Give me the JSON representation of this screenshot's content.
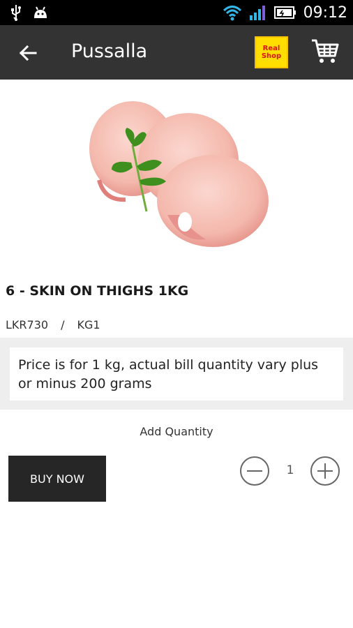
{
  "status_bar": {
    "time": "09:12",
    "icons": [
      "usb-icon",
      "android-icon",
      "wifi-icon",
      "signal-icon",
      "battery-icon"
    ]
  },
  "app_bar": {
    "title": "Pussalla",
    "logo_text": [
      "Real",
      "Shop"
    ],
    "icons": [
      "back-arrow-icon",
      "shop-logo",
      "cart-icon"
    ],
    "background": "#333333"
  },
  "product": {
    "name": "6 - SKIN ON THIGHS 1KG",
    "price": "LKR730",
    "separator": "/",
    "unit": "KG1",
    "description": "Price is for 1 kg, actual bill quantity vary plus or minus 200 grams"
  },
  "quantity": {
    "label": "Add Quantity",
    "value": "1"
  },
  "actions": {
    "buy_now": "BUY NOW"
  }
}
